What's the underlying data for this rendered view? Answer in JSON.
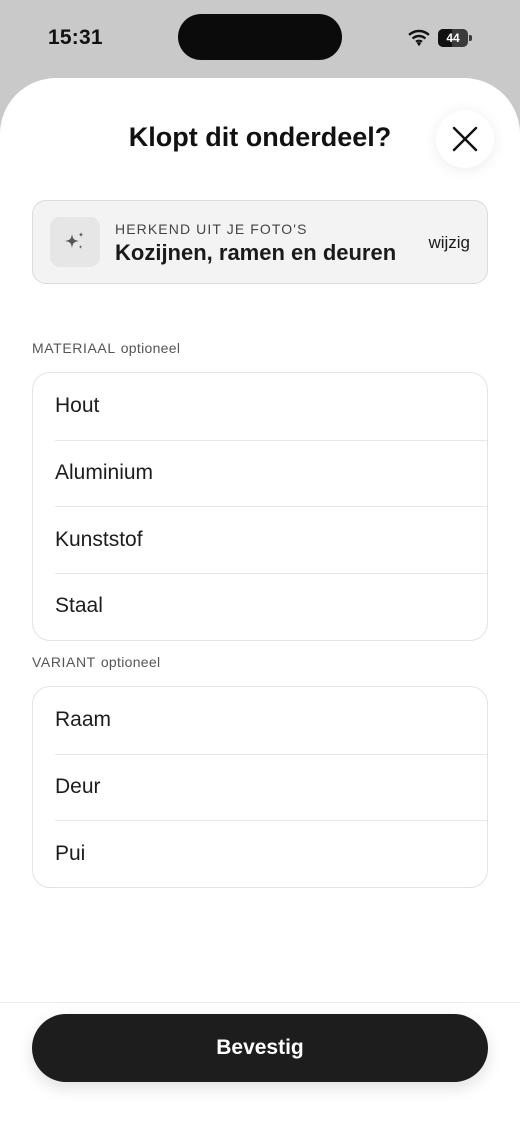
{
  "status_bar": {
    "time": "15:31",
    "battery_level": "44",
    "icons": [
      "wifi-icon",
      "battery-icon"
    ]
  },
  "sheet": {
    "title": "Klopt dit onderdeel?",
    "close_icon": "close-icon"
  },
  "recognized": {
    "caption": "HERKEND UIT JE FOTO'S",
    "value": "Kozijnen, ramen en deuren",
    "change_label": "wijzig",
    "icon": "sparkle-icon"
  },
  "material": {
    "label": "MATERIAAL",
    "optional": "optioneel",
    "options": [
      "Hout",
      "Aluminium",
      "Kunststof",
      "Staal"
    ]
  },
  "variant": {
    "label": "VARIANT",
    "optional": "optioneel",
    "options": [
      "Raam",
      "Deur",
      "Pui"
    ]
  },
  "footer": {
    "confirm_label": "Bevestig"
  },
  "colors": {
    "background": "#c9c9c9",
    "sheet": "#ffffff",
    "card": "#f3f3f3",
    "button": "#1d1d1d",
    "button_text": "#ffffff"
  }
}
